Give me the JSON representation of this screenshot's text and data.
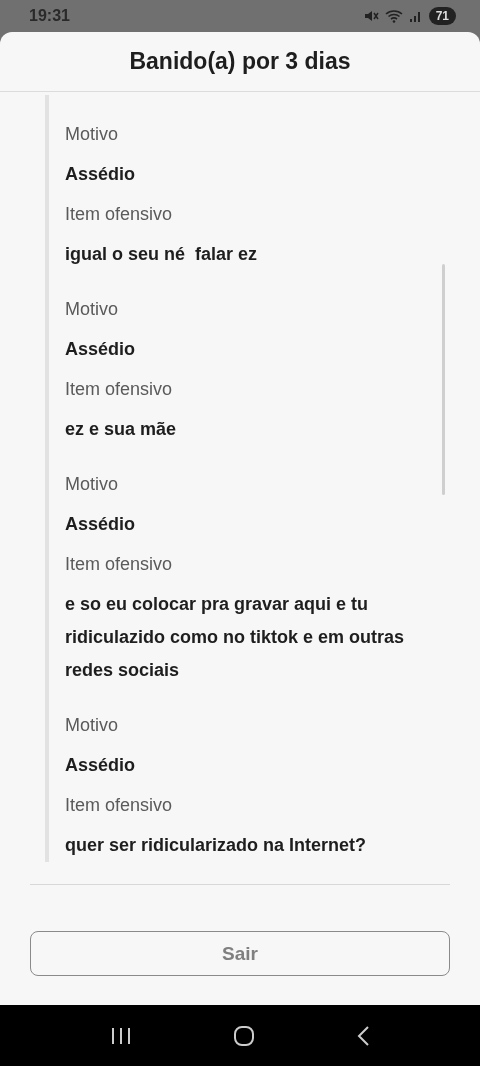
{
  "status_bar": {
    "time": "19:31",
    "battery": "71"
  },
  "sheet": {
    "title": "Banido(a) por 3 dias"
  },
  "entries": [
    {
      "reason_label": "Motivo",
      "reason": "Assédio",
      "item_label": "Item ofensivo",
      "item": "igual o seu né  falar ez"
    },
    {
      "reason_label": "Motivo",
      "reason": "Assédio",
      "item_label": "Item ofensivo",
      "item": "ez e sua mãe"
    },
    {
      "reason_label": "Motivo",
      "reason": "Assédio",
      "item_label": "Item ofensivo",
      "item": "e so eu colocar pra gravar aqui e tu ridiculazido como no tiktok e em outras redes sociais"
    },
    {
      "reason_label": "Motivo",
      "reason": "Assédio",
      "item_label": "Item ofensivo",
      "item": "quer ser ridicularizado na Internet?"
    }
  ],
  "button": {
    "label": "Sair"
  }
}
